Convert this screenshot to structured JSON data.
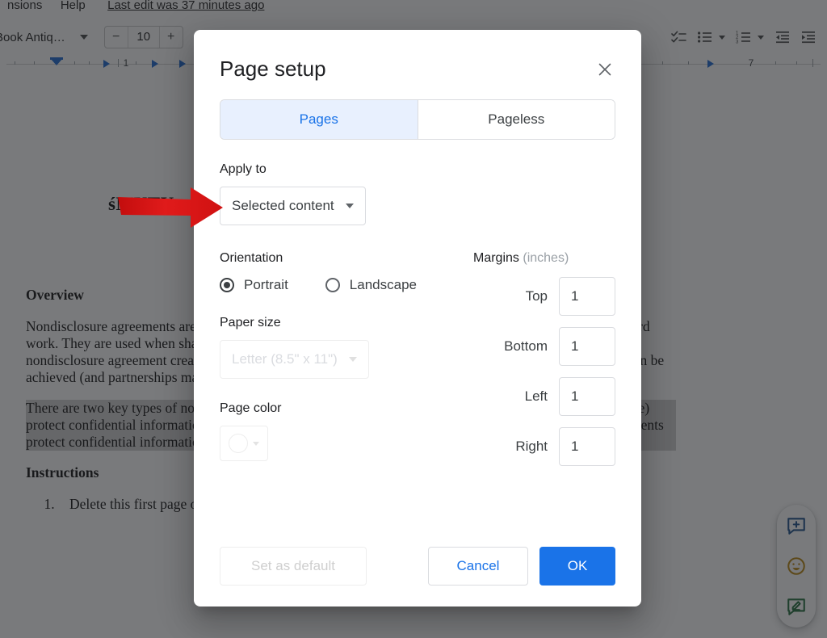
{
  "app": {
    "menubar": {
      "items": [
        "nsions",
        "Help"
      ],
      "last_edit": "Last edit was 37 minutes ago"
    },
    "toolbar": {
      "font_name": "Book Antiq…",
      "font_size": "10",
      "decrease_label": "−",
      "increase_label": "+",
      "icons": [
        "checklist-icon",
        "bulleted-list-icon",
        "numbered-list-icon",
        "decrease-indent-icon",
        "increase-indent-icon"
      ]
    },
    "ruler": {
      "left_number": "1",
      "right_number": "7"
    },
    "document": {
      "title": "śMUTU",
      "heading_overview": "Overview",
      "paragraph_1": "Nondisclosure agreements are incredibly important for businesses of all sizes to protect trade secrets, and hard work. They are used when sharing information with someone who may use that information. Once signed, a nondisclosure agreement creating an environment in which information, or trust in a business relationship can be achieved (and partnerships may be established).",
      "paragraph_2": "There are two key types of nondisclosure agreements: mutual agreements (like the agreement in this template) protect confidential information, as in the case of a joint venture, or merger. Unilateral nondisclosure agreements protect confidential information, as in the case of an employment.",
      "heading_instructions": "Instructions",
      "list_items": [
        "Delete this first page of instructions before using your template"
      ]
    },
    "side_actions": [
      {
        "name": "add-comment-icon"
      },
      {
        "name": "emoji-reaction-icon"
      },
      {
        "name": "suggest-edit-icon"
      }
    ]
  },
  "dialog": {
    "title": "Page setup",
    "close_label": "×",
    "tabs": [
      {
        "label": "Pages",
        "active": true
      },
      {
        "label": "Pageless",
        "active": false
      }
    ],
    "apply_to": {
      "label": "Apply to",
      "value": "Selected content"
    },
    "orientation": {
      "label": "Orientation",
      "options": [
        {
          "label": "Portrait",
          "checked": true
        },
        {
          "label": "Landscape",
          "checked": false
        }
      ]
    },
    "paper_size": {
      "label": "Paper size",
      "value": "Letter (8.5\" x 11\")",
      "disabled": true
    },
    "page_color": {
      "label": "Page color",
      "value": "#ffffff",
      "disabled": true
    },
    "margins": {
      "title": "Margins",
      "unit": "(inches)",
      "fields": [
        {
          "label": "Top",
          "value": "1"
        },
        {
          "label": "Bottom",
          "value": "1"
        },
        {
          "label": "Left",
          "value": "1"
        },
        {
          "label": "Right",
          "value": "1"
        }
      ]
    },
    "buttons": {
      "set_default": "Set as default",
      "cancel": "Cancel",
      "ok": "OK"
    },
    "colors": {
      "accent": "#1a73e8",
      "tab_active_bg": "#e8f0fe"
    }
  },
  "annotation": {
    "arrow_color": "#e01b1b",
    "points_to": "Selected content"
  }
}
